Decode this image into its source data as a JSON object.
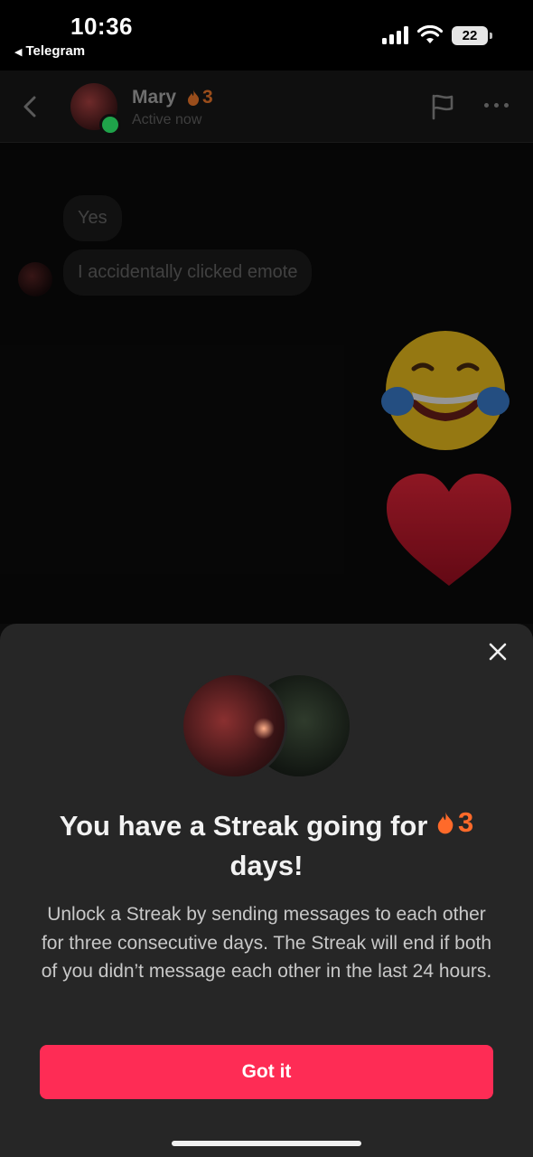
{
  "status_bar": {
    "time": "10:36",
    "back_app": "Telegram",
    "battery": "22"
  },
  "chat_header": {
    "name": "Mary",
    "streak_count": "3",
    "status": "Active now"
  },
  "messages": [
    {
      "text": "Yes"
    },
    {
      "text": "I accidentally clicked emote"
    }
  ],
  "sheet": {
    "title_before": "You have a Streak going for",
    "title_count": "3",
    "title_after": "days!",
    "description": "Unlock a Streak by sending messages to each other for three consecutive days. The Streak will end if both of you didn’t message each other in the last 24 hours.",
    "button_label": "Got it"
  },
  "colors": {
    "accent_button": "#fe2c55",
    "streak_orange": "#ff6a2a",
    "online_green": "#1fa34a",
    "sheet_bg": "#262626"
  },
  "icons": [
    "back-chevron-icon",
    "flag-icon",
    "more-icon",
    "close-icon",
    "flame-icon",
    "laughing-emoji-icon",
    "heart-emoji-icon"
  ]
}
